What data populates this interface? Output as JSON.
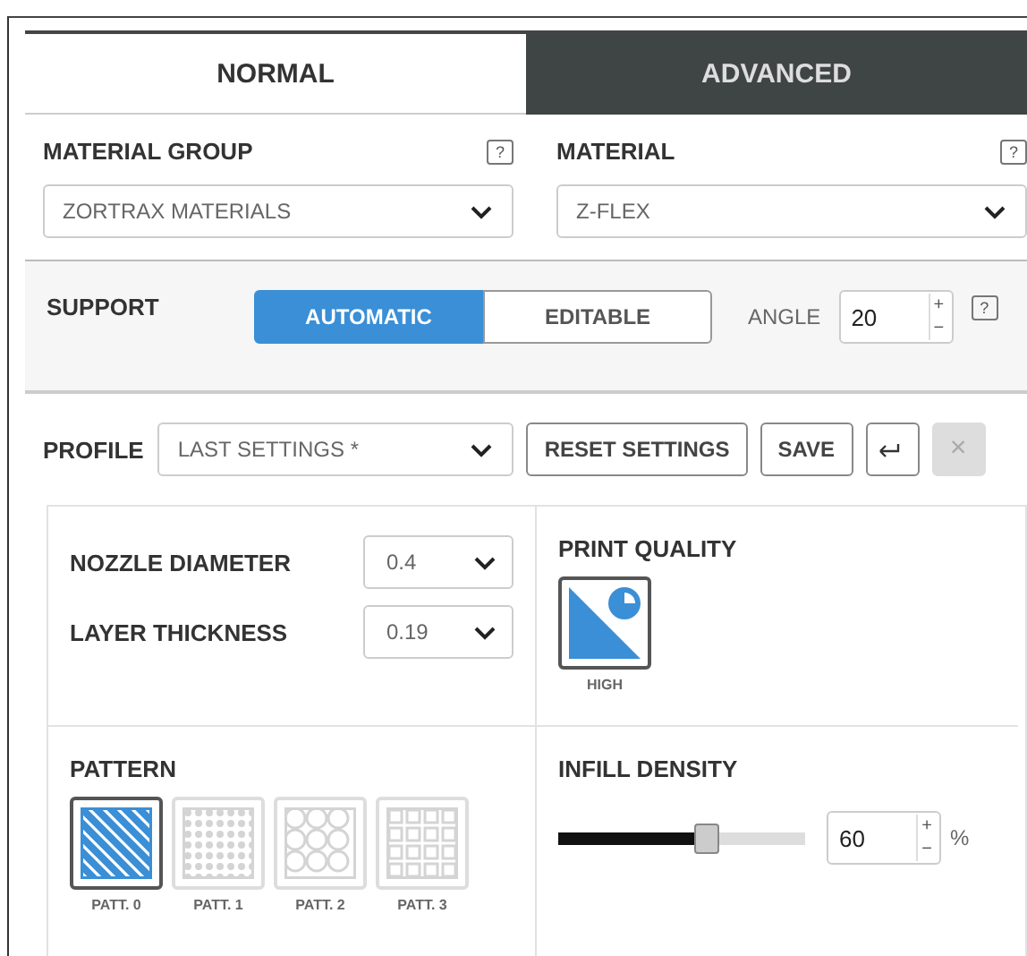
{
  "tabs": [
    {
      "label": "NORMAL",
      "selected": true
    },
    {
      "label": "ADVANCED",
      "selected": false
    }
  ],
  "material_fields": [
    {
      "label": "MATERIAL GROUP",
      "help": "?",
      "value": "ZORTRAX MATERIALS"
    },
    {
      "label": "MATERIAL",
      "help": "?",
      "value": "Z-FLEX"
    }
  ],
  "support": {
    "label": "SUPPORT",
    "options": [
      {
        "label": "AUTOMATIC",
        "selected": true
      },
      {
        "label": "EDITABLE",
        "selected": false
      }
    ],
    "angle_label": "ANGLE",
    "angle_value": "20",
    "increment": "+",
    "decrement": "−",
    "help": "?"
  },
  "profile": {
    "label": "PROFILE",
    "value": "LAST SETTINGS *",
    "buttons": [
      {
        "kind": "text",
        "label": "RESET SETTINGS",
        "disabled": false
      },
      {
        "kind": "text",
        "label": "SAVE",
        "disabled": false
      },
      {
        "kind": "back",
        "disabled": false
      },
      {
        "kind": "text",
        "label": "×",
        "disabled": true
      }
    ]
  },
  "settings": [
    {
      "label": "NOZZLE DIAMETER",
      "value": "0.4"
    },
    {
      "label": "LAYER THICKNESS",
      "value": "0.19"
    }
  ],
  "print_quality": {
    "label": "PRINT QUALITY",
    "options": [
      {
        "label": "HIGH",
        "selected": true
      }
    ]
  },
  "pattern": {
    "label": "PATTERN",
    "options": [
      {
        "kind": "stripes",
        "label": "PATT. 0",
        "selected": true
      },
      {
        "kind": "dots",
        "label": "PATT. 1",
        "selected": false
      },
      {
        "kind": "hex",
        "label": "PATT. 2",
        "selected": false
      },
      {
        "kind": "grid",
        "label": "PATT. 3",
        "selected": false
      }
    ]
  },
  "infill_density": {
    "label": "INFILL DENSITY",
    "level": 0.6,
    "value": "60",
    "increment": "+",
    "decrement": "−",
    "unit": "%"
  }
}
